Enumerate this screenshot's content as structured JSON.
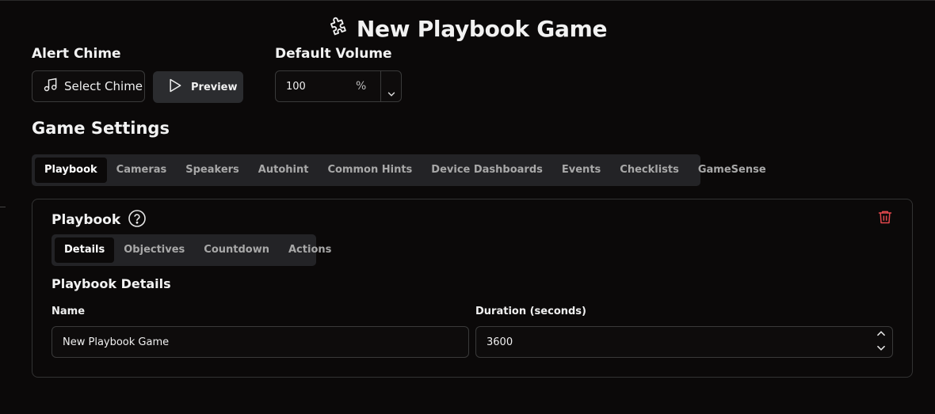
{
  "page": {
    "title": "New Playbook Game",
    "title_icon": "puzzle-icon"
  },
  "alert_chime": {
    "label": "Alert Chime",
    "select_button": {
      "label": "Select Chime",
      "icon": "music-note-icon"
    },
    "preview_button": {
      "label": "Preview",
      "icon": "play-icon"
    }
  },
  "default_volume": {
    "label": "Default Volume",
    "value": "100",
    "unit": "%"
  },
  "game_settings": {
    "title": "Game Settings",
    "tabs": [
      "Playbook",
      "Cameras",
      "Speakers",
      "Autohint",
      "Common Hints",
      "Device Dashboards",
      "Events",
      "Checklists",
      "GameSense"
    ],
    "active_tab": "Playbook"
  },
  "playbook_card": {
    "title": "Playbook",
    "tabs": [
      "Details",
      "Objectives",
      "Countdown",
      "Actions"
    ],
    "active_tab": "Details",
    "section_title": "Playbook Details",
    "name_field": {
      "label": "Name",
      "value": "New Playbook Game"
    },
    "duration_field": {
      "label": "Duration (seconds)",
      "value": "3600"
    }
  },
  "colors": {
    "background": "#0b0909",
    "tab_bar": "#232326",
    "delete": "#e5484d",
    "border": "#3a3a3a"
  }
}
